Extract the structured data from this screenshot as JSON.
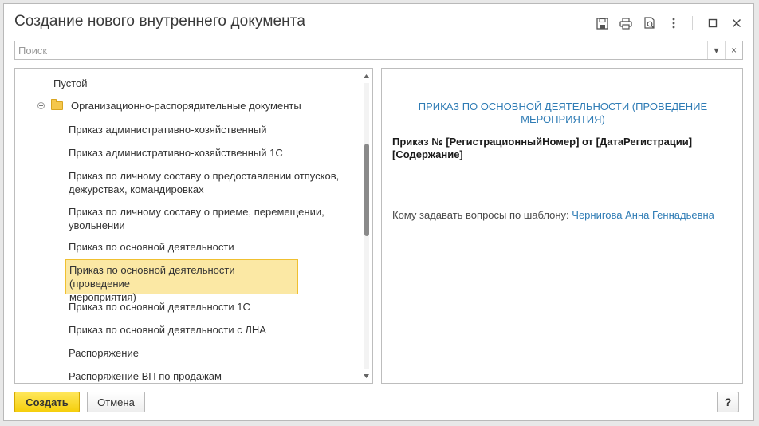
{
  "window": {
    "title": "Создание нового внутреннего документа"
  },
  "search": {
    "placeholder": "Поиск",
    "dropdown_glyph": "▾",
    "clear_glyph": "×"
  },
  "tree": {
    "empty_item": "Пустой",
    "group_label": "Организационно-распорядительные документы",
    "items": [
      {
        "line1": "Приказ административно-хозяйственный",
        "line2": ""
      },
      {
        "line1": "Приказ административно-хозяйственный 1С",
        "line2": ""
      },
      {
        "line1": "Приказ по личному составу о предоставлении отпусков,",
        "line2": "дежурствах, командировках"
      },
      {
        "line1": "Приказ по личному составу о приеме, перемещении,",
        "line2": "увольнении"
      },
      {
        "line1": "Приказ по основной деятельности",
        "line2": ""
      },
      {
        "line1": "Приказ по основной деятельности (проведение",
        "line2": "мероприятия)"
      },
      {
        "line1": "Приказ по основной деятельности 1С",
        "line2": ""
      },
      {
        "line1": "Приказ по основной деятельности с ЛНА",
        "line2": ""
      },
      {
        "line1": "Распоряжение",
        "line2": ""
      },
      {
        "line1": "Распоряжение ВП по продажам",
        "line2": ""
      }
    ]
  },
  "preview": {
    "heading_line1": "ПРИКАЗ ПО ОСНОВНОЙ ДЕЯТЕЛЬНОСТИ (ПРОВЕДЕНИЕ",
    "heading_line2": "МЕРОПРИЯТИЯ)",
    "body_line1": "Приказ № [РегистрационныйНомер] от [ДатаРегистрации]",
    "body_line2": "[Содержание]",
    "contact_label": "Кому задавать вопросы по шаблону:",
    "contact_name": "Чернигова Анна Геннадьевна"
  },
  "buttons": {
    "create": "Создать",
    "cancel": "Отмена",
    "help": "?"
  },
  "colors": {
    "accent_link": "#2f7cb5",
    "selection_fill": "#fbe8a4",
    "selection_border": "#f0c030",
    "primary_button": "#f5cf0c"
  }
}
